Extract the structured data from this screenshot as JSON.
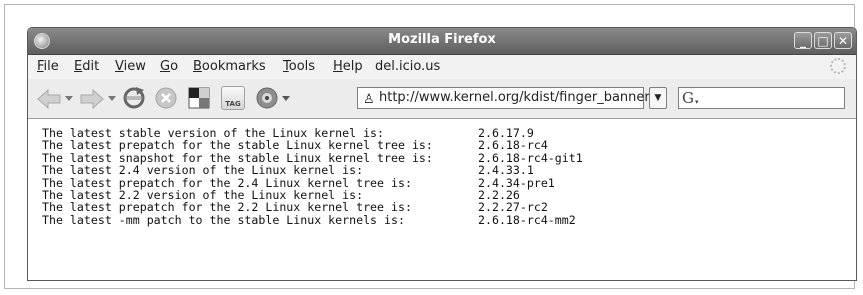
{
  "window": {
    "title": "Mozilla Firefox"
  },
  "menubar": [
    {
      "label": "File",
      "accel": "F",
      "rest": "ile"
    },
    {
      "label": "Edit",
      "accel": "E",
      "rest": "dit"
    },
    {
      "label": "View",
      "accel": "V",
      "rest": "iew"
    },
    {
      "label": "Go",
      "accel": "G",
      "rest": "o"
    },
    {
      "label": "Bookmarks",
      "accel": "B",
      "rest": "ookmarks"
    },
    {
      "label": "Tools",
      "accel": "T",
      "rest": "ools"
    },
    {
      "label": "Help",
      "accel": "H",
      "rest": "elp"
    },
    {
      "label": "del.icio.us",
      "accel": "",
      "rest": "del.icio.us"
    }
  ],
  "toolbar": {
    "url": "http://www.kernel.org/kdist/finger_banner",
    "search_value": "",
    "tag_label": "TAG",
    "search_engine_letter": "G"
  },
  "kernel_lines": [
    {
      "label": "The latest stable version of the Linux kernel is:",
      "version": "2.6.17.9"
    },
    {
      "label": "The latest prepatch for the stable Linux kernel tree is:",
      "version": "2.6.18-rc4"
    },
    {
      "label": "The latest snapshot for the stable Linux kernel tree is:",
      "version": "2.6.18-rc4-git1"
    },
    {
      "label": "The latest 2.4 version of the Linux kernel is:",
      "version": "2.4.33.1"
    },
    {
      "label": "The latest prepatch for the 2.4 Linux kernel tree is:",
      "version": "2.4.34-pre1"
    },
    {
      "label": "The latest 2.2 version of the Linux kernel is:",
      "version": "2.2.26"
    },
    {
      "label": "The latest prepatch for the 2.2 Linux kernel tree is:",
      "version": "2.2.27-rc2"
    },
    {
      "label": "The latest -mm patch to the stable Linux kernels is:",
      "version": "2.6.18-rc4-mm2"
    }
  ],
  "icons": {
    "back": "back-arrow-icon",
    "forward": "forward-arrow-icon",
    "reload": "reload-icon",
    "stop": "stop-icon",
    "home": "home-icon",
    "tag": "tag-icon",
    "bookmark": "bookmark-icon",
    "site": "site-favicon-icon",
    "dropdown": "chevron-down-icon",
    "search_engine": "google-icon",
    "throbber": "throbber-icon"
  },
  "colors": {
    "titlebar": "#6e6e6e",
    "title_text": "#ffffff",
    "content_text": "#111111"
  }
}
